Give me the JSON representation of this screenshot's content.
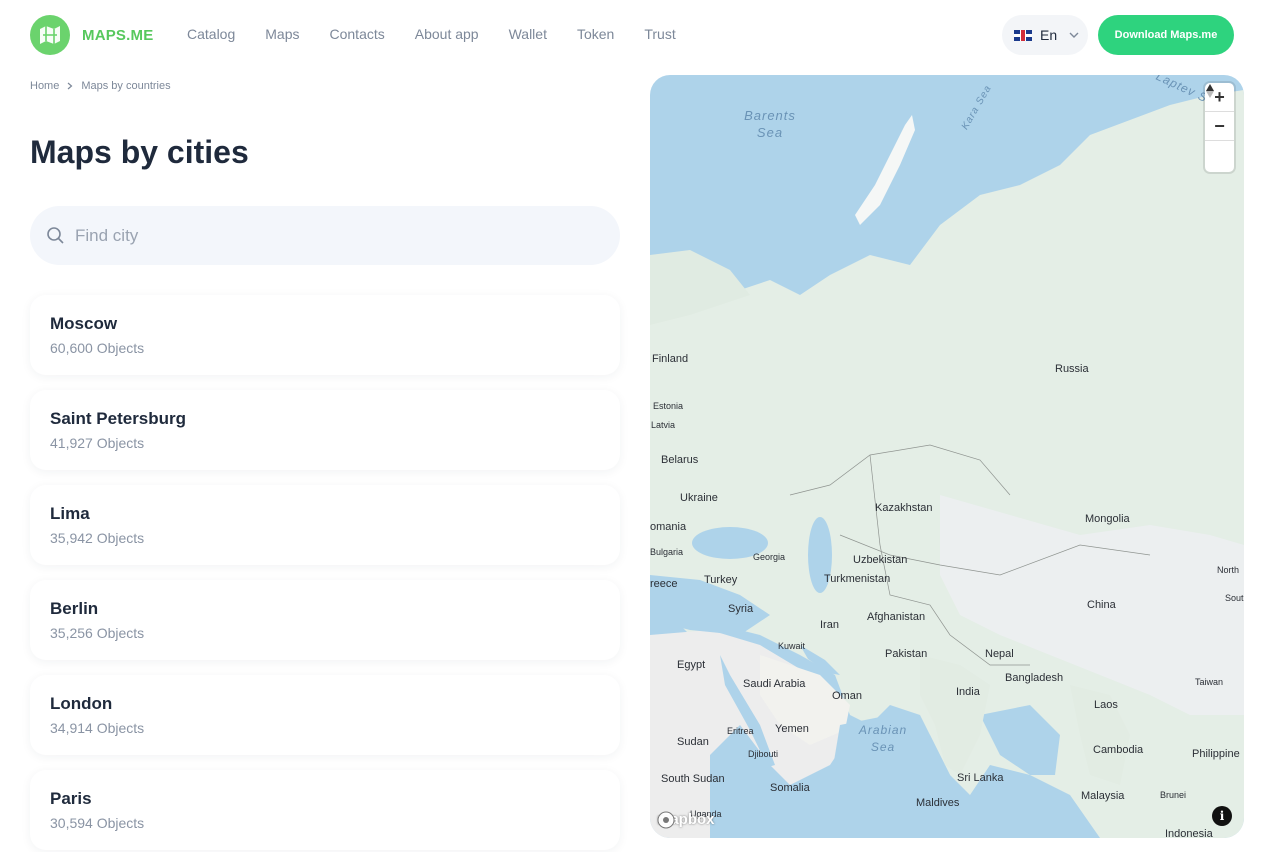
{
  "header": {
    "logo_text": "MAPS.ME",
    "nav": [
      "Catalog",
      "Maps",
      "Contacts",
      "About app",
      "Wallet",
      "Token",
      "Trust"
    ],
    "language": "En",
    "download_label": "Download Maps.me"
  },
  "breadcrumb": {
    "home": "Home",
    "current": "Maps by countries"
  },
  "page_title": "Maps by cities",
  "search": {
    "placeholder": "Find city",
    "value": ""
  },
  "cities": [
    {
      "name": "Moscow",
      "count": "60,600 Objects"
    },
    {
      "name": "Saint Petersburg",
      "count": "41,927 Objects"
    },
    {
      "name": "Lima",
      "count": "35,942 Objects"
    },
    {
      "name": "Berlin",
      "count": "35,256 Objects"
    },
    {
      "name": "London",
      "count": "34,914 Objects"
    },
    {
      "name": "Paris",
      "count": "30,594 Objects"
    }
  ],
  "map": {
    "seas": [
      "Barents Sea",
      "Kara Sea",
      "Laptev S",
      "Arabian Sea"
    ],
    "countries": [
      "Finland",
      "Russia",
      "Estonia",
      "Latvia",
      "Belarus",
      "Ukraine",
      "omania",
      "Kazakhstan",
      "Mongolia",
      "Bulgaria",
      "Georgia",
      "Uzbekistan",
      "reece",
      "Turkey",
      "Turkmenistan",
      "North",
      "Syria",
      "China",
      "Sout",
      "Afghanistan",
      "Iran",
      "Kuwait",
      "Pakistan",
      "Egypt",
      "Nepal",
      "Saudi Arabia",
      "Bangladesh",
      "India",
      "Oman",
      "Taiwan",
      "Laos",
      "Eritrea",
      "Yemen",
      "Sudan",
      "Djibouti",
      "Cambodia",
      "Philippine",
      "Sri Lanka",
      "South Sudan",
      "Somalia",
      "Malaysia",
      "Brunei",
      "Maldives",
      "Uganda",
      "Indonesia"
    ],
    "attribution": "mapbox",
    "zoom_in": "+",
    "zoom_out": "−",
    "compass": "▲",
    "info": "i"
  },
  "colors": {
    "brand_green": "#57c85d",
    "button_green": "#2ed37e",
    "water": "#aed3ea",
    "land": "#e3eee5"
  }
}
